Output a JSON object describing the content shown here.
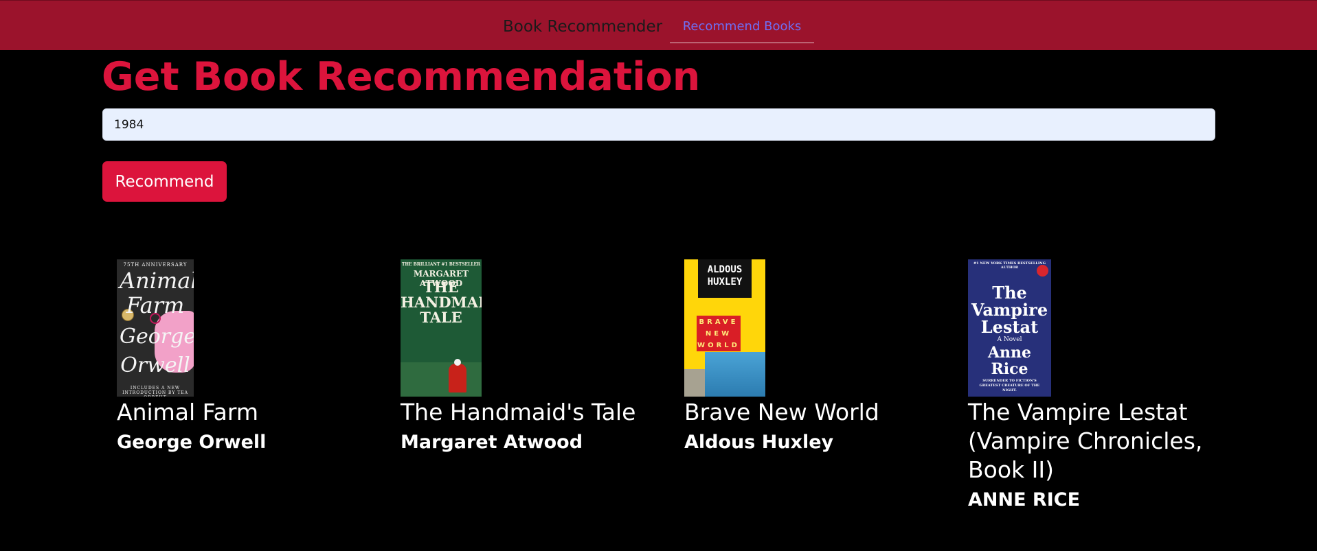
{
  "navbar": {
    "brand": "Book Recommender",
    "link": "Recommend Books",
    "background_color": "#9b132c",
    "link_color": "#6f6ef2"
  },
  "main": {
    "title": "Get Book Recommendation",
    "search": {
      "value": "1984",
      "placeholder": ""
    },
    "button_label": "Recommend",
    "accent_color": "#dc143c"
  },
  "books": [
    {
      "title": "Animal Farm",
      "author": "George Orwell",
      "cover": {
        "top_line": "75TH ANNIVERSARY",
        "line1": "Animal",
        "line2": "Farm",
        "line3": "George",
        "line4": "Orwell",
        "bottom_line": "INCLUDES A NEW INTRODUCTION BY TEA OBREHT"
      }
    },
    {
      "title": "The Handmaid's Tale",
      "author": "Margaret Atwood",
      "cover": {
        "top_line": "THE BRILLIANT #1 BESTSELLER",
        "author": "MARGARET ATWOOD",
        "title": "THE HANDMAID'S TALE"
      }
    },
    {
      "title": "Brave New World",
      "author": "Aldous Huxley",
      "cover": {
        "author": "ALDOUS HUXLEY",
        "title": "BRAVE NEW WORLD"
      }
    },
    {
      "title": "The Vampire Lestat (Vampire Chronicles, Book II)",
      "author": "ANNE RICE",
      "cover": {
        "top_line": "#1 NEW YORK TIMES BESTSELLING AUTHOR",
        "title": "The Vampire Lestat",
        "subtitle": "A Novel",
        "author": "Anne Rice",
        "bottom_line": "SURRENDER TO FICTION'S GREATEST CREATURE OF THE NIGHT."
      }
    }
  ]
}
